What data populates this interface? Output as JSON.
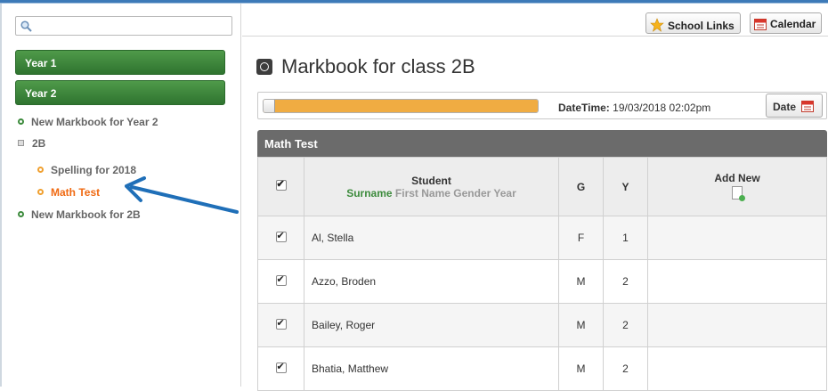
{
  "search": {
    "placeholder": ""
  },
  "toolbar": {
    "school_links_label": "School Links",
    "calendar_label": "Calendar"
  },
  "sidebar": {
    "year_groups": [
      {
        "label": "Year 1"
      },
      {
        "label": "Year 2"
      }
    ],
    "tree": [
      {
        "label": "New Markbook for Year 2",
        "bullet": "green"
      },
      {
        "label": "2B",
        "bullet": "square"
      },
      {
        "label": "Spelling for 2018",
        "bullet": "orange"
      },
      {
        "label": "Math Test",
        "bullet": "orange",
        "active": true
      },
      {
        "label": "New Markbook for 2B",
        "bullet": "green"
      }
    ]
  },
  "main": {
    "title": "Markbook for class 2B",
    "progress": {
      "fraction": 1.0
    },
    "datetime_label": "DateTime:",
    "datetime_value": "19/03/2018 02:02pm",
    "date_button_label": "Date",
    "grid_title": "Math Test",
    "columns": {
      "student": "Student",
      "student_sub_highlight": "Surname",
      "student_sub_rest": "First Name Gender Year",
      "g": "G",
      "y": "Y",
      "add_new": "Add New"
    },
    "rows": [
      {
        "name": "Al, Stella",
        "g": "F",
        "y": "1"
      },
      {
        "name": "Azzo, Broden",
        "g": "M",
        "y": "2"
      },
      {
        "name": "Bailey, Roger",
        "g": "M",
        "y": "2"
      },
      {
        "name": "Bhatia, Matthew",
        "g": "M",
        "y": "2"
      }
    ]
  },
  "colors": {
    "year_bar": "#3a8a3a",
    "active_item": "#f06a12",
    "progress_fill": "#f0ac42",
    "grid_header": "#6b6b6b",
    "annotation_arrow": "#1f6fb8"
  }
}
